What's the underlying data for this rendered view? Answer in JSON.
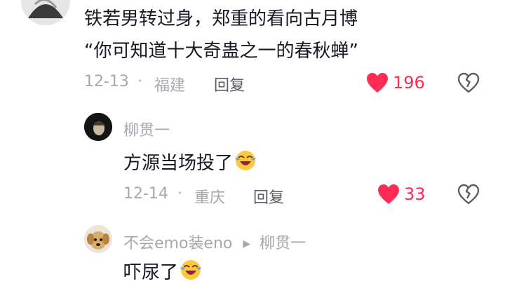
{
  "comment": {
    "line1": "铁若男转过身，郑重的看向古月博",
    "line2": "“你可知道十大奇蛊之一的春秋蝉”",
    "date": "12-13",
    "location": "福建",
    "reply_label": "回复",
    "likes": "196"
  },
  "reply1": {
    "username": "柳贯一",
    "text": "方源当场投了",
    "emoji": "crying-laughing-emoji",
    "date": "12-14",
    "location": "重庆",
    "reply_label": "回复",
    "likes": "33"
  },
  "reply2": {
    "username": "不会emo装eno",
    "reply_to": "柳贯一",
    "text": "吓尿了",
    "emoji": "crying-laughing-emoji"
  },
  "separator": "·",
  "colors": {
    "like": "#fe2c55",
    "meta": "#a6a8ad",
    "text": "#161823"
  }
}
